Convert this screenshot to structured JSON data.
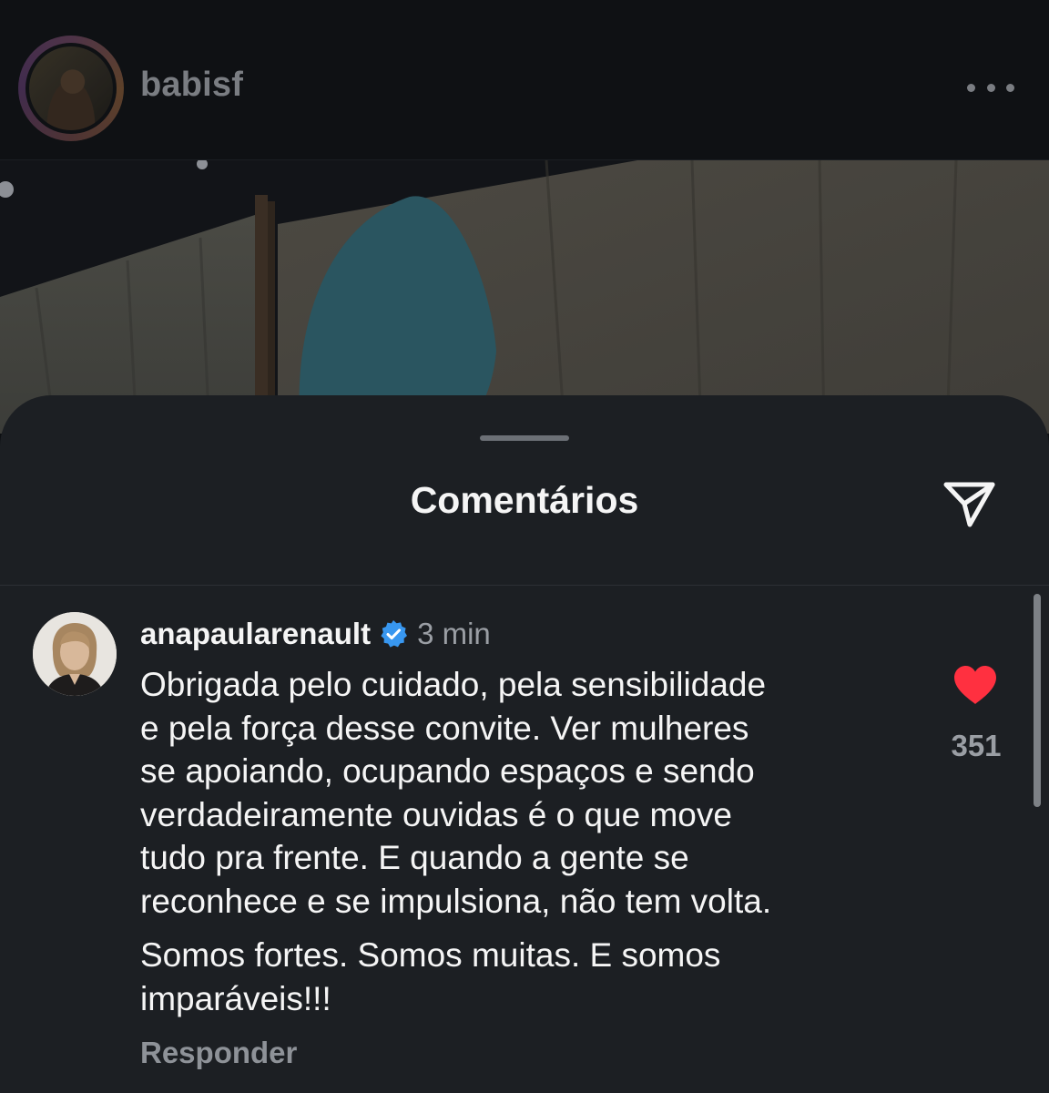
{
  "post": {
    "username": "babisf",
    "more_icon": "more-horizontal-icon"
  },
  "comments_sheet": {
    "title": "Comentários",
    "share_icon": "send-icon"
  },
  "comment": {
    "username": "anapaularenault",
    "verified": true,
    "verified_color": "#3897f0",
    "time": "3 min",
    "paragraphs": [
      "Obrigada pelo cuidado, pela sensibilidade\ne pela força desse convite. Ver mulheres\nse apoiando, ocupando espaços e sendo\nverdadeiramente ouvidas é o que move\ntudo pra frente. E quando a gente se\nreconhece e se impulsiona, não tem volta.",
      "Somos fortes. Somos muitas. E somos\nimparáveis!!!"
    ],
    "reply_label": "Responder",
    "liked": true,
    "like_color": "#ff3040",
    "like_count": "351"
  }
}
